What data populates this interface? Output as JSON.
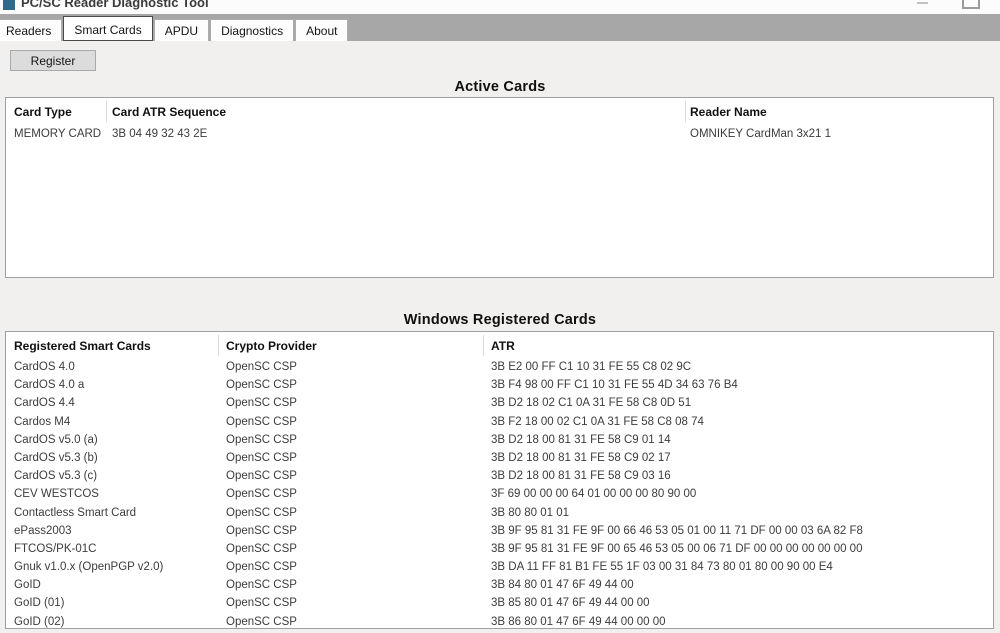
{
  "window": {
    "title": "PC/SC Reader Diagnostic Tool"
  },
  "tabs": [
    {
      "label": "Readers",
      "selected": false
    },
    {
      "label": "Smart Cards",
      "selected": true
    },
    {
      "label": "APDU",
      "selected": false
    },
    {
      "label": "Diagnostics",
      "selected": false
    },
    {
      "label": "About",
      "selected": false
    }
  ],
  "toolbar": {
    "register_label": "Register"
  },
  "active_cards": {
    "title": "Active Cards",
    "columns": [
      "Card Type",
      "Card ATR Sequence",
      "Reader Name"
    ],
    "rows": [
      {
        "card_type": "MEMORY CARD",
        "atr": "3B 04 49 32 43 2E",
        "reader": "OMNIKEY CardMan 3x21 1"
      }
    ]
  },
  "registered_cards": {
    "title": "Windows Registered Cards",
    "columns": [
      "Registered Smart Cards",
      "Crypto Provider",
      "ATR"
    ],
    "rows": [
      {
        "name": "CardOS 4.0",
        "provider": "OpenSC CSP",
        "atr": "3B E2 00 FF C1 10 31 FE 55 C8 02 9C"
      },
      {
        "name": "CardOS 4.0 a",
        "provider": "OpenSC CSP",
        "atr": "3B F4 98 00 FF C1 10 31 FE 55 4D 34 63 76 B4"
      },
      {
        "name": "CardOS 4.4",
        "provider": "OpenSC CSP",
        "atr": "3B D2 18 02 C1 0A 31 FE 58 C8 0D 51"
      },
      {
        "name": "Cardos M4",
        "provider": "OpenSC CSP",
        "atr": "3B F2 18 00 02 C1 0A 31 FE 58 C8 08 74"
      },
      {
        "name": "CardOS v5.0 (a)",
        "provider": "OpenSC CSP",
        "atr": "3B D2 18 00 81 31 FE 58 C9 01 14"
      },
      {
        "name": "CardOS v5.3 (b)",
        "provider": "OpenSC CSP",
        "atr": "3B D2 18 00 81 31 FE 58 C9 02 17"
      },
      {
        "name": "CardOS v5.3 (c)",
        "provider": "OpenSC CSP",
        "atr": "3B D2 18 00 81 31 FE 58 C9 03 16"
      },
      {
        "name": "CEV WESTCOS",
        "provider": "OpenSC CSP",
        "atr": "3F 69 00 00 00 64 01 00 00 00 80 90 00"
      },
      {
        "name": "Contactless Smart Card",
        "provider": "OpenSC CSP",
        "atr": "3B 80 80 01 01"
      },
      {
        "name": "ePass2003",
        "provider": "OpenSC CSP",
        "atr": "3B 9F 95 81 31 FE 9F 00 66 46 53 05 01 00 11 71 DF 00 00 03 6A 82 F8"
      },
      {
        "name": "FTCOS/PK-01C",
        "provider": "OpenSC CSP",
        "atr": "3B 9F 95 81 31 FE 9F 00 65 46 53 05 00 06 71 DF 00 00 00 00 00 00 00"
      },
      {
        "name": "Gnuk v1.0.x (OpenPGP v2.0)",
        "provider": "OpenSC CSP",
        "atr": "3B DA 11 FF 81 B1 FE 55 1F 03 00 31 84 73 80 01 80 00 90 00 E4"
      },
      {
        "name": "GoID",
        "provider": "OpenSC CSP",
        "atr": "3B 84 80 01 47 6F 49 44 00"
      },
      {
        "name": "GoID (01)",
        "provider": "OpenSC CSP",
        "atr": "3B 85 80 01 47 6F 49 44 00 00"
      },
      {
        "name": "GoID (02)",
        "provider": "OpenSC CSP",
        "atr": "3B 86 80 01 47 6F 49 44 00 00 00"
      }
    ]
  },
  "colors": {
    "titlebar_icon": "#2d6a8c",
    "tab_band": "#a7a7a7",
    "content_background": "#f1f0ef",
    "panel_border": "#a0a0a0",
    "button_background": "#dcdcdc"
  }
}
